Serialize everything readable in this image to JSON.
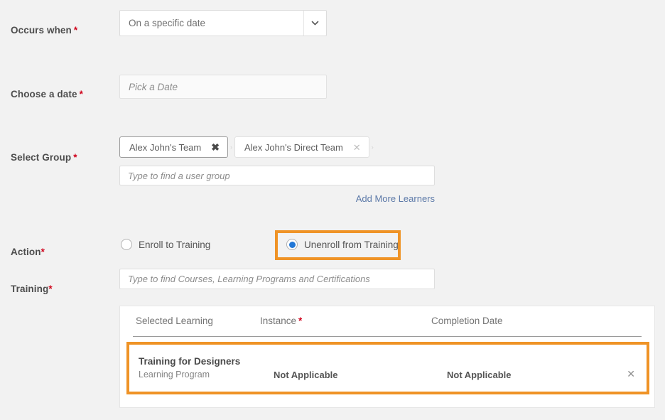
{
  "fields": {
    "occurs_when": {
      "label": "Occurs when",
      "required_mark": "*",
      "selected_value": "On a specific date",
      "chevron_icon": "chevron-down-icon"
    },
    "choose_date": {
      "label": "Choose a date",
      "required_mark": "*",
      "placeholder": "Pick a Date",
      "value": ""
    },
    "select_group": {
      "label": "Select Group",
      "required_mark": "*",
      "chips": [
        {
          "text": "Alex John's Team",
          "remove_icon": "close-icon"
        },
        {
          "text": "Alex John's Direct Team",
          "remove_icon": "close-icon"
        }
      ],
      "chip_separator": "›",
      "placeholder": "Type to find a user group",
      "value": "",
      "add_more_link": "Add More Learners"
    },
    "action": {
      "label": "Action",
      "required_mark": "*",
      "options": [
        {
          "label": "Enroll to Training",
          "selected": false
        },
        {
          "label": "Unenroll from Training",
          "selected": true
        }
      ]
    },
    "training": {
      "label": "Training",
      "required_mark": "*",
      "placeholder": "Type to find Courses, Learning Programs and Certifications",
      "value": ""
    }
  },
  "table": {
    "columns": [
      {
        "label": "Selected Learning",
        "required_mark": ""
      },
      {
        "label": "Instance",
        "required_mark": "*"
      },
      {
        "label": "Completion Date",
        "required_mark": ""
      }
    ],
    "rows": [
      {
        "title": "Training for Designers",
        "subtitle": "Learning Program",
        "instance": "Not Applicable",
        "completion_date": "Not Applicable",
        "remove_icon": "close-icon",
        "highlighted": true
      }
    ]
  },
  "colors": {
    "highlight": "#ef9326",
    "radio_selected": "#2277d6",
    "link": "#5c79a8",
    "required": "#d0021b",
    "background": "#f2f2f2"
  }
}
